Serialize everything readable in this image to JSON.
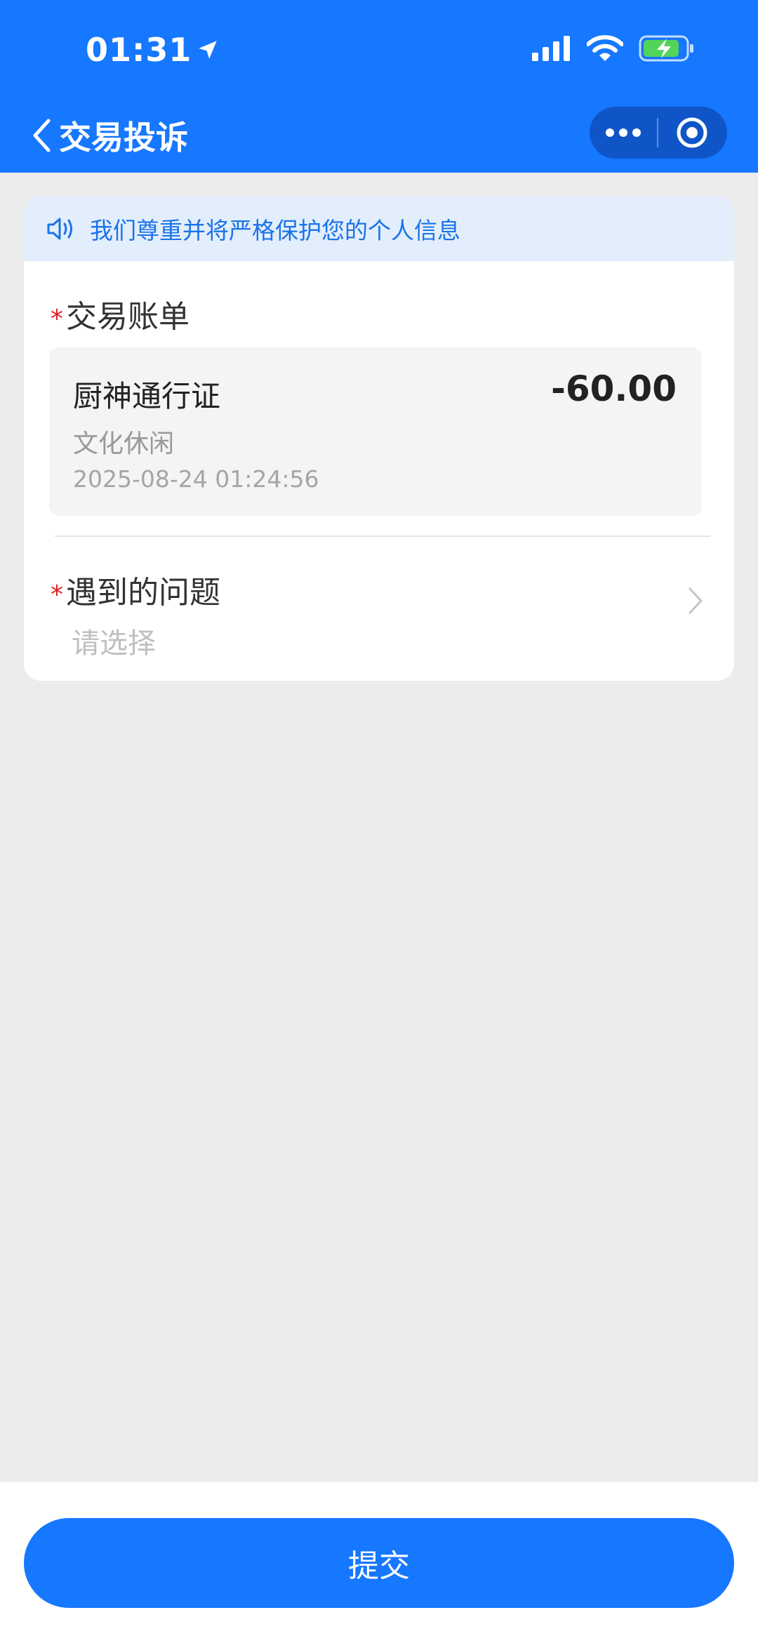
{
  "status_bar": {
    "time": "01:31"
  },
  "nav": {
    "title": "交易投诉"
  },
  "notice": {
    "text": "我们尊重并将严格保护您的个人信息"
  },
  "bill_section": {
    "required_mark": "*",
    "title": "交易账单",
    "bill": {
      "name": "厨神通行证",
      "amount": "-60.00",
      "category": "文化休闲",
      "datetime": "2025-08-24 01:24:56"
    }
  },
  "problem_section": {
    "required_mark": "*",
    "title": "遇到的问题",
    "placeholder": "请选择"
  },
  "submit": {
    "label": "提交"
  },
  "colors": {
    "primary": "#1677ff",
    "required": "#e02020",
    "notice_bg": "#e3eefc"
  }
}
